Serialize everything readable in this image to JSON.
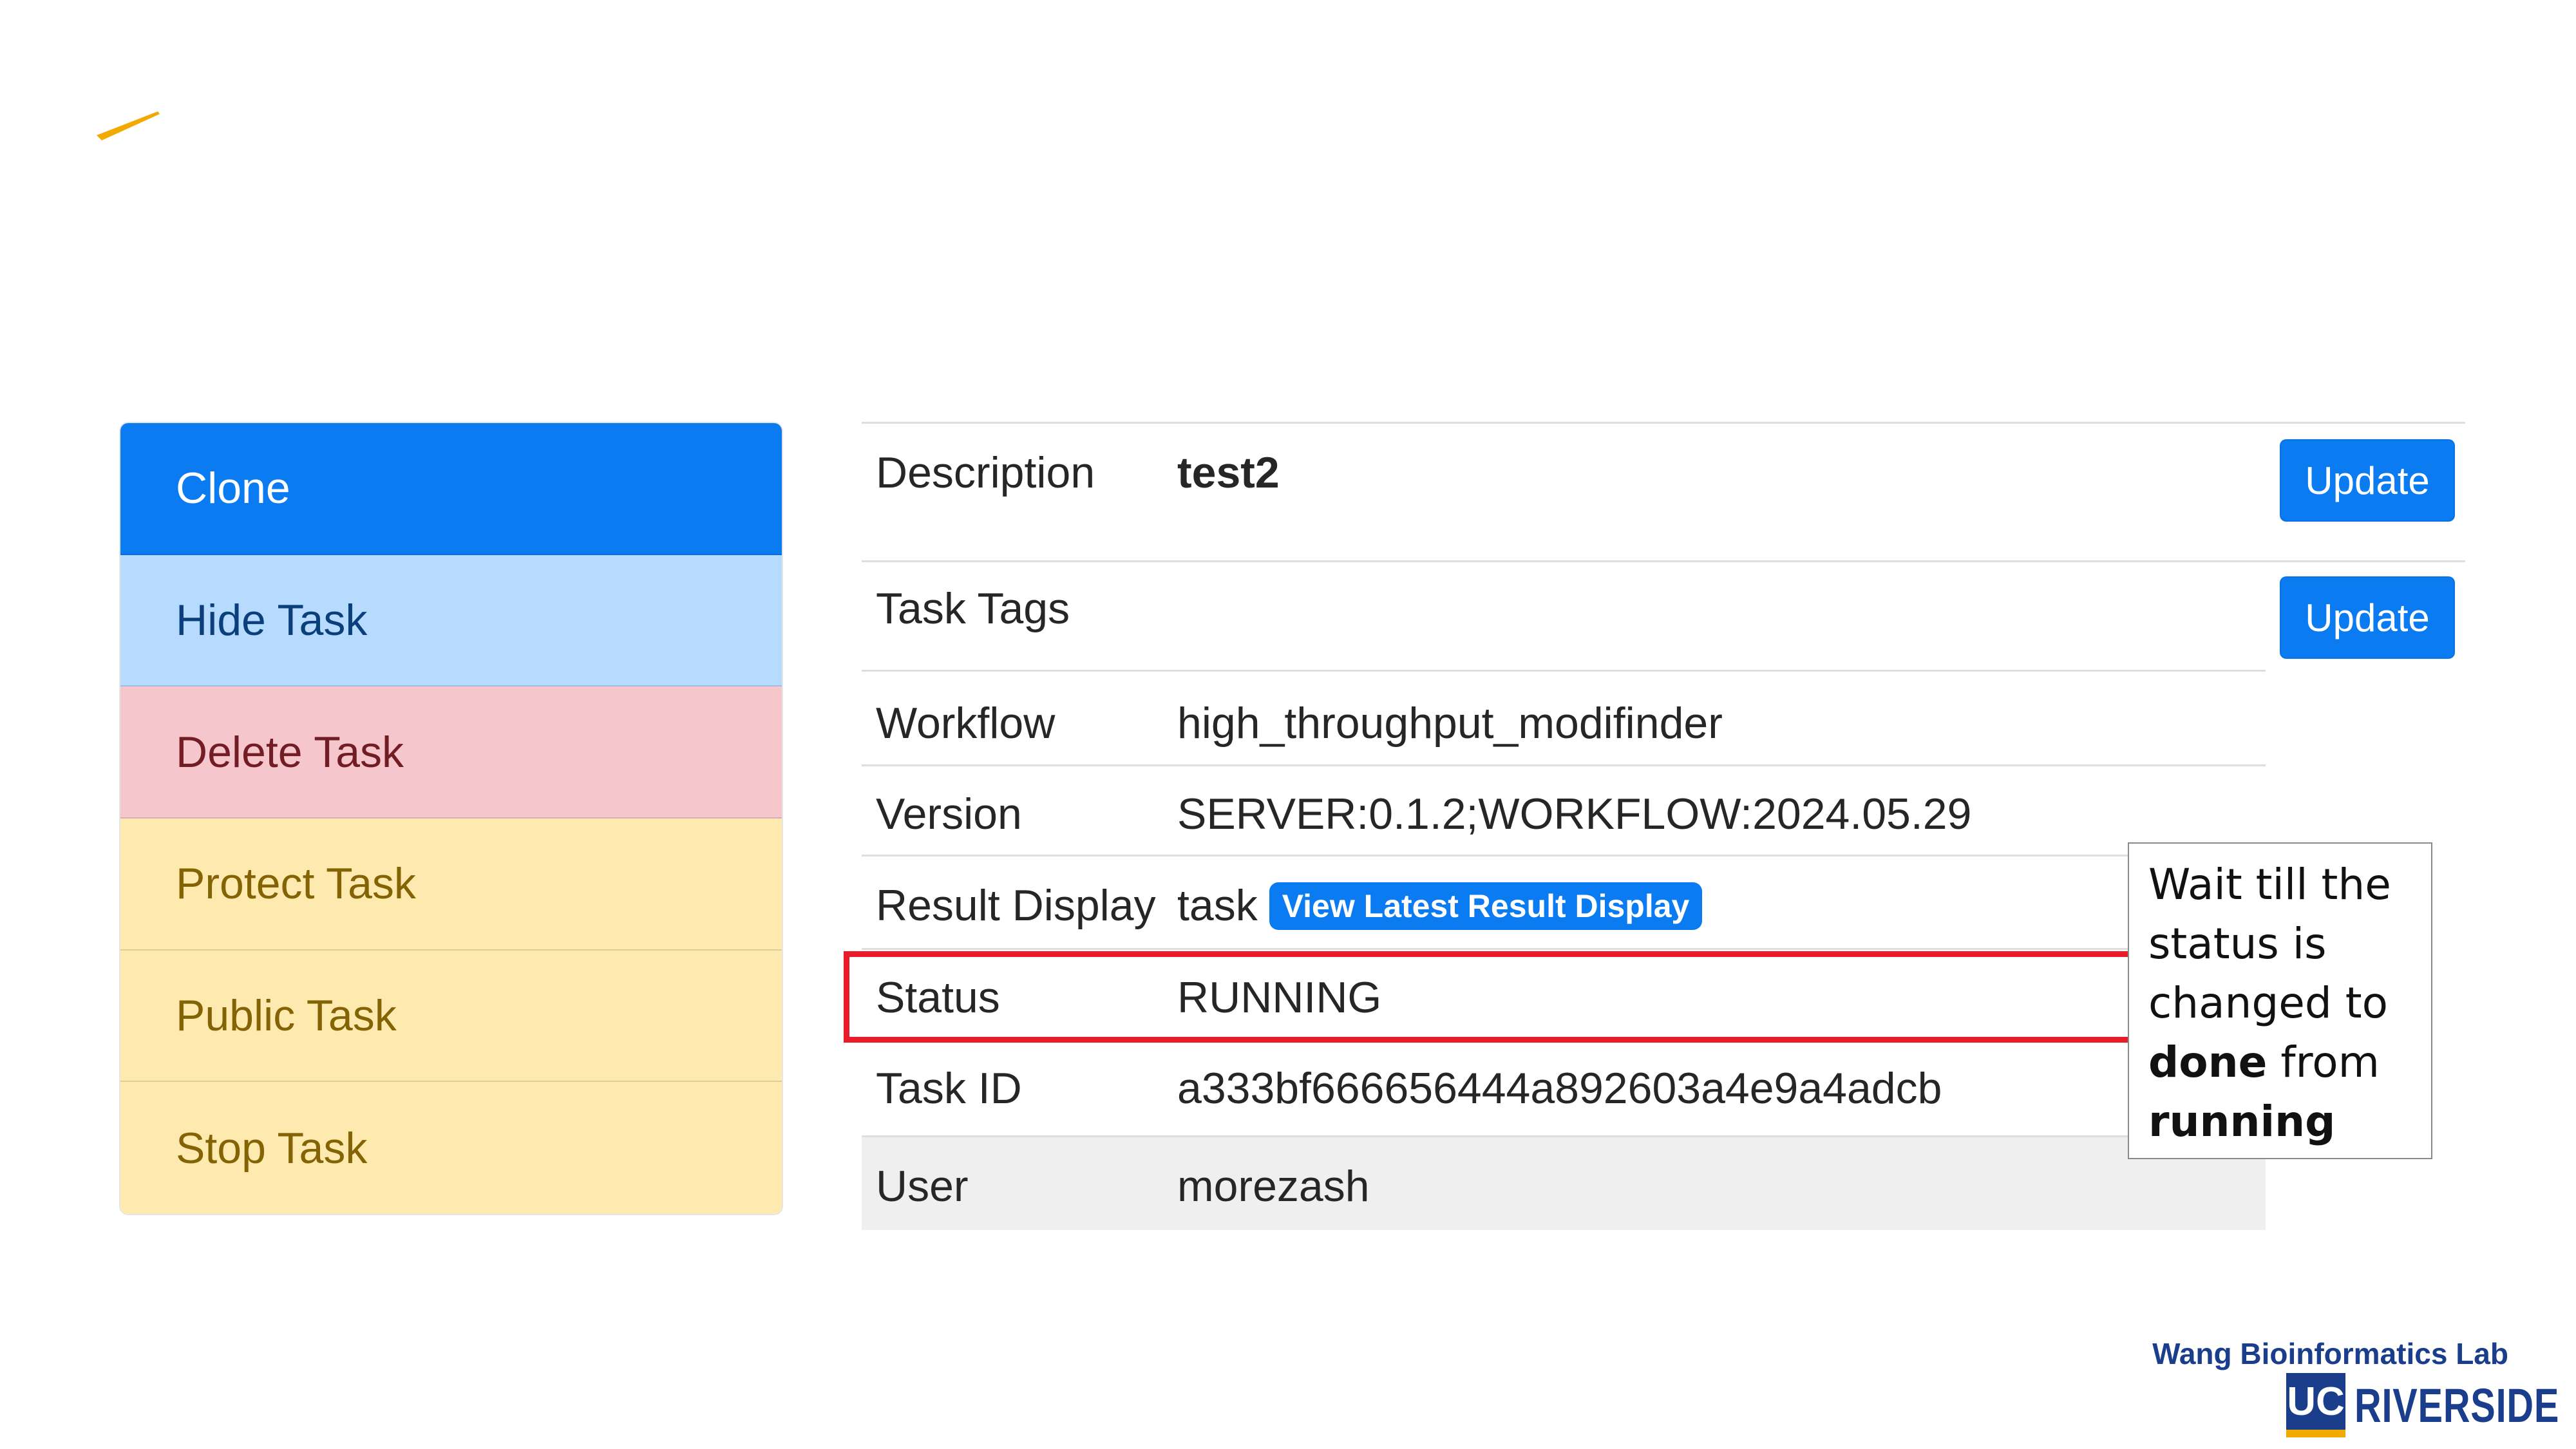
{
  "actions": [
    {
      "label": "Clone"
    },
    {
      "label": "Hide Task"
    },
    {
      "label": "Delete Task"
    },
    {
      "label": "Protect Task"
    },
    {
      "label": "Public Task"
    },
    {
      "label": "Stop Task"
    }
  ],
  "details": {
    "description": {
      "label": "Description",
      "value": "test2",
      "button": "Update"
    },
    "task_tags": {
      "label": "Task Tags",
      "value": "",
      "button": "Update"
    },
    "workflow": {
      "label": "Workflow",
      "value": "high_throughput_modifinder"
    },
    "version": {
      "label": "Version",
      "value": "SERVER:0.1.2;WORKFLOW:2024.05.29"
    },
    "result_display": {
      "label": "Result Display",
      "value": "task",
      "badge": "View Latest Result Display"
    },
    "status": {
      "label": "Status",
      "value": "RUNNING"
    },
    "task_id": {
      "label": "Task ID",
      "value": "a333bf666656444a892603a4e9a4adcb"
    },
    "user": {
      "label": "User",
      "value": "morezash"
    }
  },
  "note": {
    "line1": "Wait till the",
    "line2": "status is",
    "line3": "changed to",
    "bold1": "done",
    "mid": " from",
    "bold2": "running"
  },
  "footer": {
    "lab_name": "Wang Bioinformatics Lab",
    "uc_mark": "UC",
    "institution": "RIVERSIDE"
  },
  "colors": {
    "primary": "#0b7bf2",
    "highlight": "#ea1c2a",
    "accent": "#f1ab00",
    "brand_blue": "#1a3e8c"
  },
  "icons": [
    "accent-stroke-icon",
    "uc-logo-icon"
  ]
}
